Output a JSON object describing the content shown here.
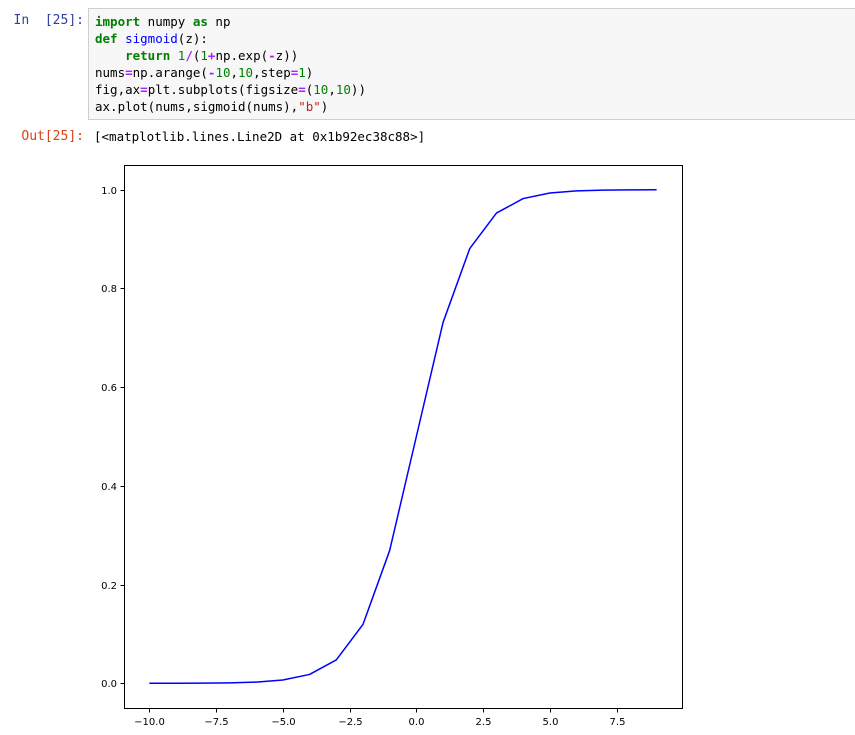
{
  "cell": {
    "in_prompt": "In  [25]:",
    "out_prompt": "Out[25]:",
    "output_text": "[<matplotlib.lines.Line2D at 0x1b92ec38c88>]"
  },
  "code": {
    "line1": {
      "kw1": "import",
      "t1": " numpy ",
      "kw2": "as",
      "t2": " np"
    },
    "line2": {
      "kw": "def",
      "sp": " ",
      "fn": "sigmoid",
      "rest": "(z):"
    },
    "line3": {
      "indent": "    ",
      "kw": "return",
      "sp": " ",
      "n1": "1",
      "op1": "/",
      "p1": "(",
      "n2": "1",
      "op2": "+",
      "t1": "np.exp(",
      "op3": "-",
      "t2": "z))"
    },
    "line4": {
      "t1": "nums",
      "op1": "=",
      "t2": "np.arange(",
      "op2": "-",
      "n1": "10",
      "c1": ",",
      "n2": "10",
      "t3": ",step",
      "op3": "=",
      "n3": "1",
      "t4": ")"
    },
    "line5": {
      "t1": "fig,ax",
      "op1": "=",
      "t2": "plt.subplots(figsize",
      "op2": "=",
      "t3": "(",
      "n1": "10",
      "c1": ",",
      "n2": "10",
      "t4": "))"
    },
    "line6": {
      "t1": "ax.plot(nums,sigmoid(nums),",
      "str": "\"b\"",
      "t2": ")"
    }
  },
  "chart_data": {
    "type": "line",
    "xlim": [
      -10.95,
      9.95
    ],
    "ylim": [
      -0.05,
      1.05
    ],
    "xticks": [
      -10.0,
      -7.5,
      -5.0,
      -2.5,
      0.0,
      2.5,
      5.0,
      7.5
    ],
    "xtick_labels": [
      "−10.0",
      "−7.5",
      "−5.0",
      "−2.5",
      "0.0",
      "2.5",
      "5.0",
      "7.5"
    ],
    "yticks": [
      0.0,
      0.2,
      0.4,
      0.6,
      0.8,
      1.0
    ],
    "ytick_labels": [
      "0.0",
      "0.2",
      "0.4",
      "0.6",
      "0.8",
      "1.0"
    ],
    "grid": false,
    "color": "#0000ff",
    "x": [
      -10,
      -9,
      -8,
      -7,
      -6,
      -5,
      -4,
      -3,
      -2,
      -1,
      0,
      1,
      2,
      3,
      4,
      5,
      6,
      7,
      8,
      9
    ],
    "y": [
      4.54e-05,
      0.0001234,
      0.0003354,
      0.000911,
      0.002473,
      0.006693,
      0.017986,
      0.047426,
      0.119203,
      0.268941,
      0.5,
      0.731059,
      0.880797,
      0.952574,
      0.982014,
      0.993307,
      0.997527,
      0.999089,
      0.999665,
      0.999877
    ]
  }
}
